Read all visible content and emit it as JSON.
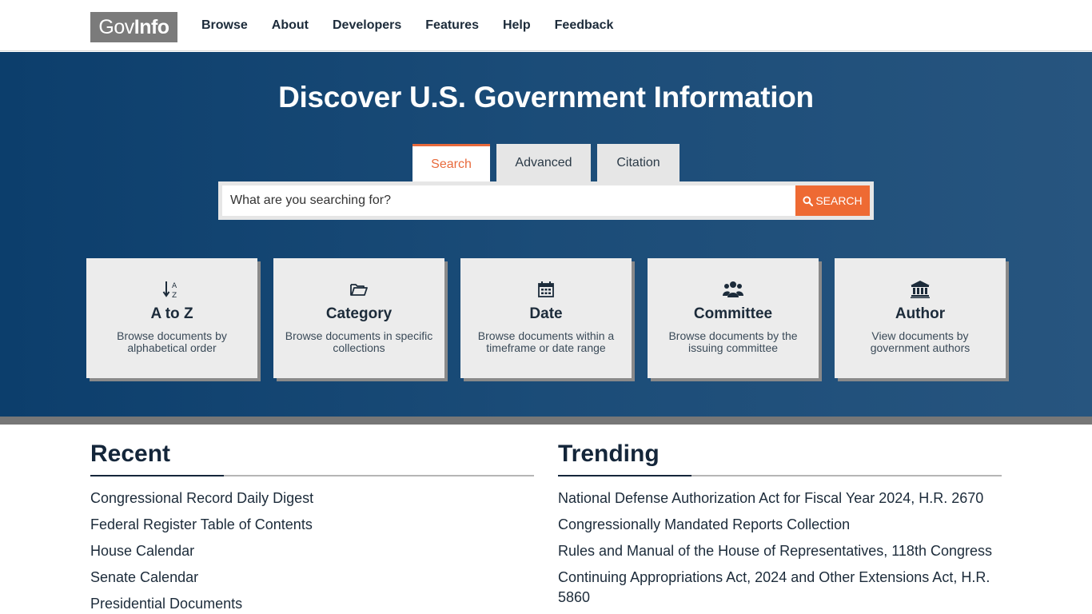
{
  "header": {
    "logo_gov": "Gov",
    "logo_info": "Info",
    "nav": [
      "Browse",
      "About",
      "Developers",
      "Features",
      "Help",
      "Feedback"
    ]
  },
  "hero": {
    "title": "Discover U.S. Government Information",
    "tabs": [
      "Search",
      "Advanced",
      "Citation"
    ],
    "active_tab": "Search",
    "search_placeholder": "What are you searching for?",
    "search_button": "SEARCH",
    "cards": [
      {
        "title": "A to Z",
        "desc": "Browse documents by alphabetical order",
        "icon": "sort-alpha-icon"
      },
      {
        "title": "Category",
        "desc": "Browse documents in specific collections",
        "icon": "folder-open-icon"
      },
      {
        "title": "Date",
        "desc": "Browse documents within a timeframe or date range",
        "icon": "calendar-icon"
      },
      {
        "title": "Committee",
        "desc": "Browse documents by the issuing committee",
        "icon": "users-icon"
      },
      {
        "title": "Author",
        "desc": "View documents by government authors",
        "icon": "institution-icon"
      }
    ]
  },
  "recent": {
    "heading": "Recent",
    "items": [
      "Congressional Record Daily Digest",
      "Federal Register Table of Contents",
      "House Calendar",
      "Senate Calendar",
      "Presidential Documents"
    ]
  },
  "trending": {
    "heading": "Trending",
    "items": [
      "National Defense Authorization Act for Fiscal Year 2024, H.R. 2670",
      "Congressionally Mandated Reports Collection",
      "Rules and Manual of the House of Representatives, 118th Congress",
      "Continuing Appropriations Act, 2024 and Other Extensions Act, H.R. 5860"
    ]
  },
  "colors": {
    "accent": "#ee6a33",
    "hero_dark": "#0c3e6c",
    "hero_light": "#27557f",
    "logo_bg": "#7b7b7b"
  }
}
